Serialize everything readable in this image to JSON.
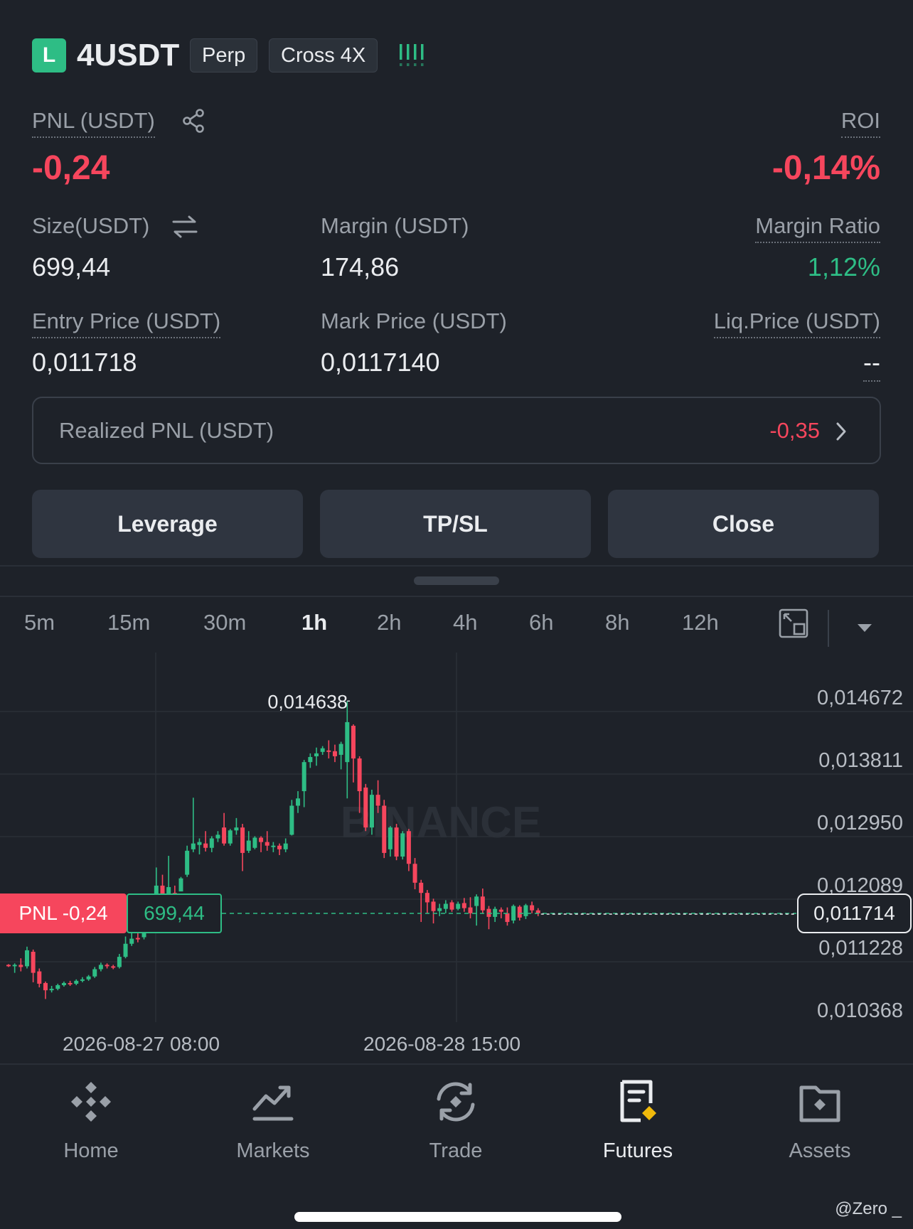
{
  "header": {
    "side_badge": "L",
    "symbol": "4USDT",
    "tags": [
      "Perp",
      "Cross 4X"
    ]
  },
  "position": {
    "pnl_label": "PNL (USDT)",
    "pnl_value": "-0,24",
    "roi_label": "ROI",
    "roi_value": "-0,14%",
    "size_label": "Size(USDT)",
    "size_value": "699,44",
    "margin_label": "Margin (USDT)",
    "margin_value": "174,86",
    "margin_ratio_label": "Margin Ratio",
    "margin_ratio_value": "1,12%",
    "entry_label": "Entry Price (USDT)",
    "entry_value": "0,011718",
    "mark_label": "Mark Price (USDT)",
    "mark_value": "0,0117140",
    "liq_label": "Liq.Price (USDT)",
    "liq_value": "--"
  },
  "realized": {
    "label": "Realized PNL (USDT)",
    "value": "-0,35"
  },
  "actions": {
    "leverage": "Leverage",
    "tpsl": "TP/SL",
    "close": "Close"
  },
  "timeframes": {
    "items": [
      "5m",
      "15m",
      "30m",
      "1h",
      "2h",
      "4h",
      "6h",
      "8h",
      "12h"
    ],
    "active": "1h"
  },
  "colors": {
    "up": "#2ebd85",
    "down": "#f6465d",
    "accent": "#f0b90b"
  },
  "chart_data": {
    "type": "candlestick",
    "y_ticks": [
      "0,014672",
      "0,013811",
      "0,012950",
      "0,012089",
      "0,011228",
      "0,010368"
    ],
    "ylim": [
      0.010368,
      0.014672
    ],
    "x_ticks": [
      "2026-08-27 08:00",
      "2026-08-28 15:00"
    ],
    "high_annotation": "0,014638",
    "current_price": "0,011714",
    "entry_price": 0.011718,
    "pnl_tag": "PNL -0,24",
    "size_tag": "699,44",
    "watermark": "BINANCE",
    "candles": [
      [
        0.01101,
        0.011,
        0.01102,
        0.01098
      ],
      [
        0.011,
        0.01101,
        0.01103,
        0.0109
      ],
      [
        0.01101,
        0.01098,
        0.0111,
        0.01092
      ],
      [
        0.01099,
        0.01121,
        0.01126,
        0.01096
      ],
      [
        0.01119,
        0.0109,
        0.01122,
        0.01077
      ],
      [
        0.01092,
        0.01075,
        0.01096,
        0.0107
      ],
      [
        0.01076,
        0.01066,
        0.01078,
        0.01054
      ],
      [
        0.01066,
        0.01068,
        0.01072,
        0.01063
      ],
      [
        0.01068,
        0.01073,
        0.01075,
        0.01066
      ],
      [
        0.01073,
        0.01076,
        0.01078,
        0.01071
      ],
      [
        0.01076,
        0.01075,
        0.01079,
        0.01072
      ],
      [
        0.01075,
        0.01079,
        0.01081,
        0.01073
      ],
      [
        0.01079,
        0.01081,
        0.01084,
        0.01077
      ],
      [
        0.01081,
        0.01085,
        0.01087,
        0.01079
      ],
      [
        0.01085,
        0.01095,
        0.01098,
        0.01083
      ],
      [
        0.01095,
        0.01101,
        0.01104,
        0.01092
      ],
      [
        0.01101,
        0.011,
        0.01103,
        0.01096
      ],
      [
        0.01099,
        0.01098,
        0.01101,
        0.01095
      ],
      [
        0.01098,
        0.01112,
        0.01116,
        0.01096
      ],
      [
        0.01112,
        0.0113,
        0.0114,
        0.0111
      ],
      [
        0.0113,
        0.01137,
        0.0115,
        0.01127
      ],
      [
        0.01138,
        0.01136,
        0.01148,
        0.01132
      ],
      [
        0.01139,
        0.0116,
        0.01176,
        0.01136
      ],
      [
        0.0116,
        0.01172,
        0.0118,
        0.01159
      ],
      [
        0.01174,
        0.0121,
        0.01235,
        0.01172
      ],
      [
        0.0121,
        0.01195,
        0.01225,
        0.01186
      ],
      [
        0.01195,
        0.01208,
        0.01251,
        0.01195
      ],
      [
        0.012,
        0.01198,
        0.0121,
        0.0118
      ],
      [
        0.01202,
        0.0122,
        0.01222,
        0.01205
      ],
      [
        0.01225,
        0.01258,
        0.01265,
        0.01222
      ],
      [
        0.0126,
        0.01268,
        0.01331,
        0.01256
      ],
      [
        0.01266,
        0.0127,
        0.01275,
        0.01253
      ],
      [
        0.01268,
        0.01262,
        0.01285,
        0.01257
      ],
      [
        0.01262,
        0.01275,
        0.01278,
        0.01256
      ],
      [
        0.01275,
        0.0128,
        0.01285,
        0.0127
      ],
      [
        0.0129,
        0.01268,
        0.0131,
        0.01265
      ],
      [
        0.01268,
        0.01286,
        0.01288,
        0.01265
      ],
      [
        0.01286,
        0.0129,
        0.01303,
        0.0128
      ],
      [
        0.0129,
        0.01255,
        0.01295,
        0.0123
      ],
      [
        0.01258,
        0.01272,
        0.01285,
        0.01255
      ],
      [
        0.01262,
        0.01276,
        0.01278,
        0.0126
      ],
      [
        0.01276,
        0.0127,
        0.01278,
        0.01256
      ],
      [
        0.0127,
        0.01265,
        0.01285,
        0.01258
      ],
      [
        0.01265,
        0.01265,
        0.0127,
        0.01256
      ],
      [
        0.01265,
        0.0126,
        0.01268,
        0.01252
      ],
      [
        0.0126,
        0.01268,
        0.01275,
        0.01256
      ],
      [
        0.0128,
        0.0132,
        0.01328,
        0.01279
      ],
      [
        0.0132,
        0.0133,
        0.0134,
        0.0131
      ],
      [
        0.0134,
        0.0138,
        0.01383,
        0.01318
      ],
      [
        0.0138,
        0.01387,
        0.01392,
        0.01372
      ],
      [
        0.01388,
        0.01392,
        0.014,
        0.01375
      ],
      [
        0.01394,
        0.01399,
        0.01402,
        0.0139
      ],
      [
        0.01396,
        0.01395,
        0.0141,
        0.01385
      ],
      [
        0.01395,
        0.01388,
        0.01404,
        0.0138
      ],
      [
        0.0139,
        0.01405,
        0.01408,
        0.0137
      ],
      [
        0.0138,
        0.01435,
        0.01464,
        0.0133
      ],
      [
        0.0143,
        0.01385,
        0.01432,
        0.01352
      ],
      [
        0.01385,
        0.0134,
        0.01388,
        0.0131
      ],
      [
        0.01345,
        0.0129,
        0.0135,
        0.01285
      ],
      [
        0.0129,
        0.01335,
        0.01342,
        0.0128
      ],
      [
        0.01335,
        0.0132,
        0.01355,
        0.0131
      ],
      [
        0.0132,
        0.01255,
        0.01328,
        0.01248
      ],
      [
        0.0126,
        0.0129,
        0.01292,
        0.0125
      ],
      [
        0.0129,
        0.0125,
        0.01295,
        0.01245
      ],
      [
        0.0125,
        0.01282,
        0.01285,
        0.01246
      ],
      [
        0.01285,
        0.0124,
        0.01288,
        0.0123
      ],
      [
        0.0124,
        0.01214,
        0.01248,
        0.01205
      ],
      [
        0.01214,
        0.012,
        0.01218,
        0.0116
      ],
      [
        0.012,
        0.01187,
        0.01204,
        0.01172
      ],
      [
        0.01188,
        0.01175,
        0.01192,
        0.01158
      ],
      [
        0.01175,
        0.01179,
        0.01185,
        0.01168
      ],
      [
        0.01178,
        0.01185,
        0.0119,
        0.01172
      ],
      [
        0.01187,
        0.01177,
        0.0119,
        0.01174
      ],
      [
        0.01178,
        0.01185,
        0.01188,
        0.01176
      ],
      [
        0.01186,
        0.01179,
        0.01193,
        0.01174
      ],
      [
        0.0118,
        0.01172,
        0.01194,
        0.01165
      ],
      [
        0.01182,
        0.01195,
        0.01198,
        0.01155
      ],
      [
        0.01195,
        0.01176,
        0.01206,
        0.01172
      ],
      [
        0.01178,
        0.01167,
        0.01182,
        0.0115
      ],
      [
        0.01167,
        0.01178,
        0.01181,
        0.0116
      ],
      [
        0.01177,
        0.01174,
        0.0118,
        0.01165
      ],
      [
        0.01172,
        0.0116,
        0.0118,
        0.01155
      ],
      [
        0.01162,
        0.01182,
        0.01184,
        0.01158
      ],
      [
        0.01181,
        0.01166,
        0.01183,
        0.01162
      ],
      [
        0.01168,
        0.01183,
        0.01185,
        0.01164
      ],
      [
        0.01183,
        0.01176,
        0.01188,
        0.01172
      ],
      [
        0.01176,
        0.01172,
        0.01179,
        0.01168
      ]
    ]
  },
  "bottom_nav": {
    "items": [
      "Home",
      "Markets",
      "Trade",
      "Futures",
      "Assets"
    ],
    "active": "Futures"
  },
  "watermark_user": "@Zero _"
}
